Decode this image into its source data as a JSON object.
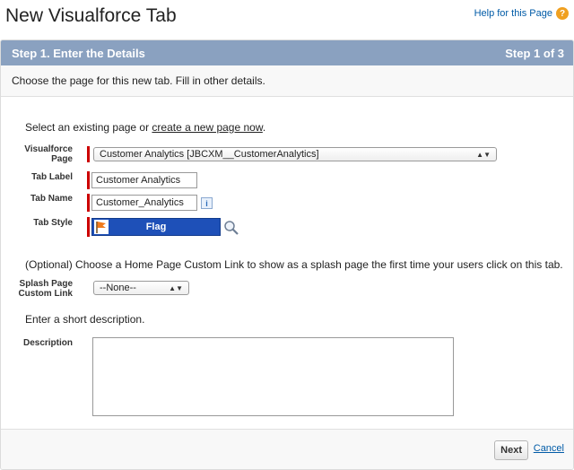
{
  "header": {
    "title": "New Visualforce Tab",
    "help_link": "Help for this Page",
    "help_icon": "?"
  },
  "step": {
    "title": "Step 1. Enter the Details",
    "indicator": "Step 1 of 3"
  },
  "instructions": "Choose the page for this new tab. Fill in other details.",
  "select_prompt": {
    "prefix": "Select an existing page or ",
    "link": "create a new page now",
    "suffix": "."
  },
  "fields": {
    "visualforce_page": {
      "label": "Visualforce Page",
      "value": "Customer Analytics [JBCXM__CustomerAnalytics]"
    },
    "tab_label": {
      "label": "Tab Label",
      "value": "Customer Analytics"
    },
    "tab_name": {
      "label": "Tab Name",
      "value": "Customer_Analytics",
      "info_icon": "i"
    },
    "tab_style": {
      "label": "Tab Style",
      "value": "Flag",
      "color": "#1e50b8"
    }
  },
  "optional_text": "(Optional) Choose a Home Page Custom Link to show as a splash page the first time your users click on this tab.",
  "splash_page": {
    "label": "Splash Page Custom Link",
    "value": "--None--"
  },
  "description_prompt": "Enter a short description.",
  "description": {
    "label": "Description",
    "value": ""
  },
  "footer": {
    "next": "Next",
    "cancel": "Cancel"
  },
  "colors": {
    "header_bg": "#8aa1c0",
    "required": "#cc0000",
    "link": "#015ba7"
  }
}
